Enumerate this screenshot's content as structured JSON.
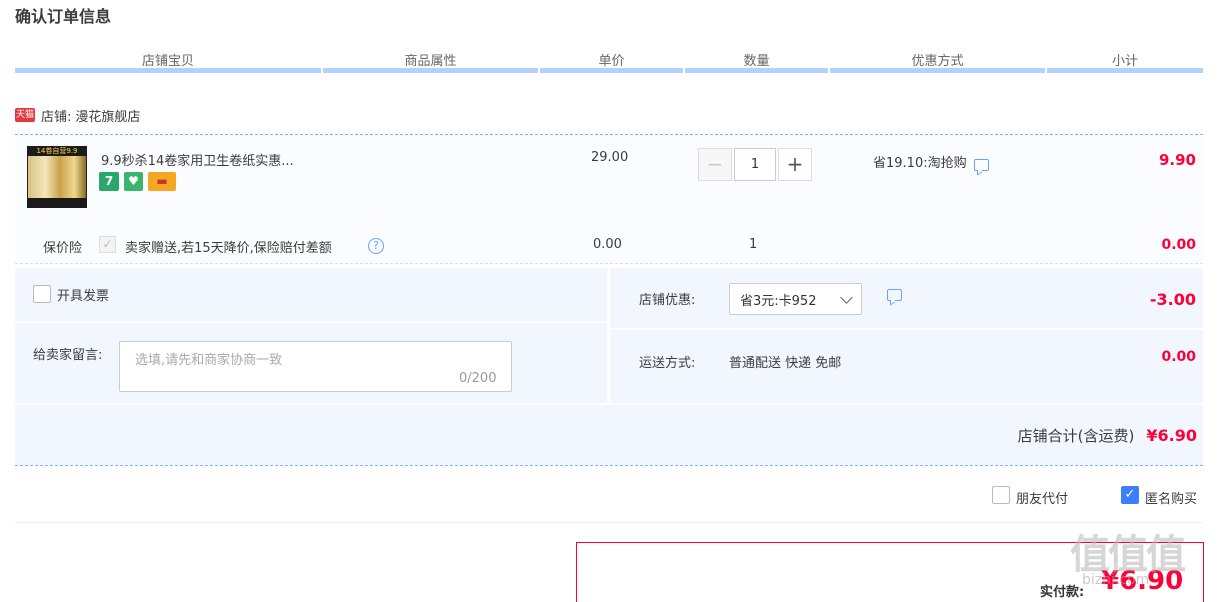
{
  "page": {
    "title": "确认订单信息"
  },
  "table_headers": [
    "店铺宝贝",
    "商品属性",
    "单价",
    "数量",
    "优惠方式",
    "小计"
  ],
  "shop": {
    "badge": "天猫",
    "label": "店铺:",
    "name": "漫花旗舰店"
  },
  "item": {
    "thumb_text": "14卷自营9.9",
    "title": "9.9秒杀14卷家用卫生卷纸实惠...",
    "icons": [
      {
        "name": "seven-day-return-icon",
        "glyph": "7",
        "color": "#2aa86b"
      },
      {
        "name": "shield-guarantee-icon",
        "glyph": "♥",
        "color": "#3bb56b"
      },
      {
        "name": "card-payment-icon",
        "glyph": "▬",
        "color": "#f5a623"
      }
    ],
    "unit_price": "29.00",
    "quantity": "1",
    "qty_minus": "−",
    "qty_plus": "+",
    "discount": "省19.10:淘抢购",
    "subtotal": "9.90"
  },
  "insurance": {
    "label": "保价险",
    "check_glyph": "✓",
    "text": "卖家赠送,若15天降价,保险赔付差额",
    "help_glyph": "?",
    "price": "0.00",
    "quantity": "1",
    "subtotal": "0.00"
  },
  "invoice": {
    "label": "开具发票"
  },
  "memo": {
    "label": "给卖家留言:",
    "placeholder": "选填,请先和商家协商一致",
    "counter": "0/200"
  },
  "shop_discount": {
    "label": "店铺优惠:",
    "selected": "省3元:卡952",
    "amount": "-3.00"
  },
  "shipping": {
    "label": "运送方式:",
    "method": "普通配送 快递 免邮",
    "amount": "0.00"
  },
  "shop_total": {
    "label": "店铺合计(含运费)",
    "amount": "¥6.90"
  },
  "options": {
    "friend_pay": "朋友代付",
    "anonymous": "匿名购买",
    "anonymous_checked": true,
    "check_glyph": "✓"
  },
  "payment": {
    "label": "实付款:",
    "amount": "¥6.90"
  },
  "watermark": {
    "text": "值值值",
    "url": "bizhi.com"
  },
  "colors": {
    "accent": "#ff0036",
    "header_bar": "#b2d1ff",
    "panel": "#f2f7ff",
    "checkbox_blue": "#3d7eff"
  }
}
